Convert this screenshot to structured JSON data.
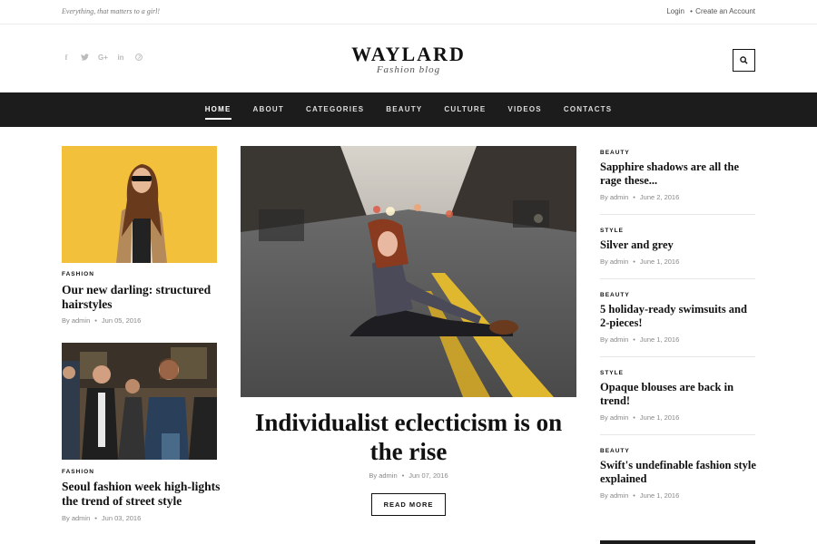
{
  "topbar": {
    "tagline": "Everything, that matters to a girl!",
    "login": "Login",
    "separator": "•",
    "create_account": "Create an Account"
  },
  "header": {
    "logo_title": "WAYLARD",
    "logo_subtitle": "Fashion blog",
    "social": [
      "facebook-icon",
      "twitter-icon",
      "google-plus-icon",
      "linkedin-icon",
      "pinterest-icon"
    ]
  },
  "nav": {
    "items": [
      "HOME",
      "ABOUT",
      "CATEGORIES",
      "BEAUTY",
      "CULTURE",
      "VIDEOS",
      "CONTACTS"
    ],
    "active": "HOME"
  },
  "left_posts": [
    {
      "category": "FASHION",
      "title": "Our new darling: structured hairstyles",
      "author": "By admin",
      "date": "Jun 05, 2016"
    },
    {
      "category": "FASHION",
      "title": "Seoul fashion week high-lights the trend of street style",
      "author": "By admin",
      "date": "Jun 03, 2016"
    }
  ],
  "featured": {
    "title": "Individualist eclecticism is on the rise",
    "author": "By admin",
    "date": "Jun 07, 2016",
    "button": "READ MORE"
  },
  "right_posts": [
    {
      "category": "BEAUTY",
      "title": "Sapphire shadows are all the rage these...",
      "author": "By admin",
      "date": "June 2, 2016"
    },
    {
      "category": "STYLE",
      "title": "Silver and grey",
      "author": "By admin",
      "date": "June 1, 2016"
    },
    {
      "category": "BEAUTY",
      "title": "5 holiday-ready swimsuits and 2-pieces!",
      "author": "By admin",
      "date": "June 1, 2016"
    },
    {
      "category": "STYLE",
      "title": "Opaque blouses are back in trend!",
      "author": "By admin",
      "date": "June 1, 2016"
    },
    {
      "category": "BEAUTY",
      "title": "Swift's undefinable fashion style explained",
      "author": "By admin",
      "date": "June 1, 2016"
    }
  ],
  "colors": {
    "nav_bg": "#1c1c1c",
    "text": "#111111",
    "meta": "#888888"
  }
}
